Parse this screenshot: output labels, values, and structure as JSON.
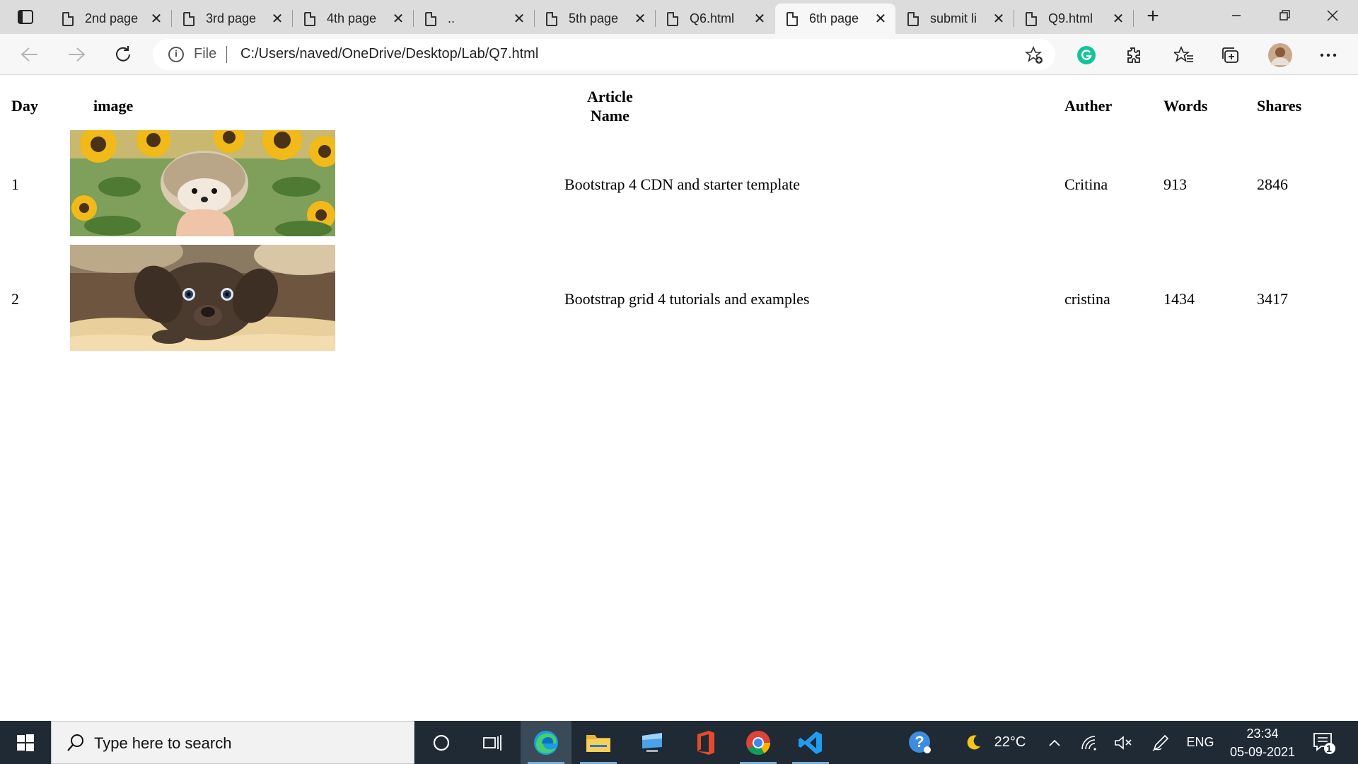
{
  "browser": {
    "tabs": [
      {
        "title": "2nd page",
        "active": false
      },
      {
        "title": "3rd page",
        "active": false
      },
      {
        "title": "4th page",
        "active": false
      },
      {
        "title": "..",
        "active": false
      },
      {
        "title": "5th page",
        "active": false
      },
      {
        "title": "Q6.html",
        "active": false
      },
      {
        "title": "6th page",
        "active": true
      },
      {
        "title": "submit li",
        "active": false
      },
      {
        "title": "Q9.html",
        "active": false
      }
    ],
    "address": {
      "scheme_label": "File",
      "url": "C:/Users/naved/OneDrive/Desktop/Lab/Q7.html"
    }
  },
  "table": {
    "headers": {
      "day": "Day",
      "image": "image",
      "article_line1": "Article",
      "article_line2": "Name",
      "author": "Auther",
      "words": "Words",
      "shares": "Shares"
    },
    "rows": [
      {
        "day": "1",
        "image": "hedgehog in sunflower field",
        "article": "Bootstrap 4 CDN and starter template",
        "author": "Critina",
        "words": "913",
        "shares": "2846"
      },
      {
        "day": "2",
        "image": "brown puppy lying on blanket",
        "article": "Bootstrap grid 4 tutorials and examples",
        "author": "cristina",
        "words": "1434",
        "shares": "3417"
      }
    ]
  },
  "taskbar": {
    "search_placeholder": "Type here to search",
    "weather": "22°C",
    "language": "ENG",
    "time": "23:34",
    "date": "05-09-2021",
    "notification_count": "1",
    "accent_color": "#7aaed6"
  }
}
